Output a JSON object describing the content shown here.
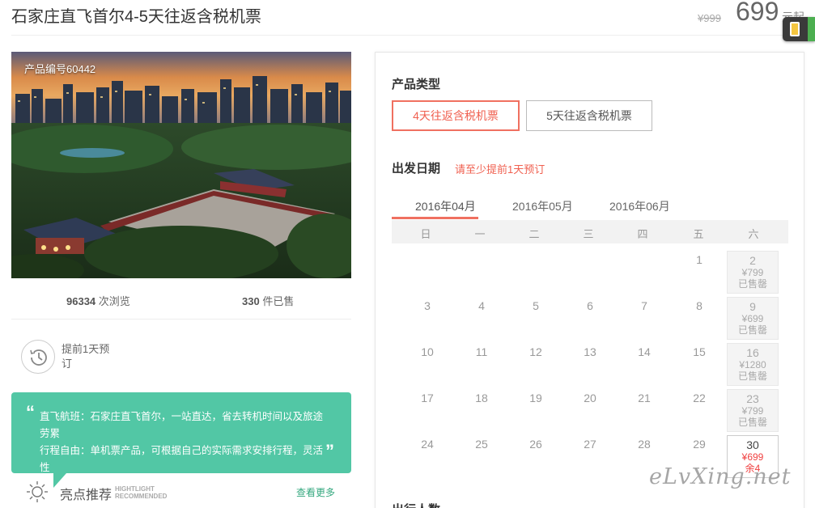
{
  "header": {
    "title": "石家庄直飞首尔4-5天往返含税机票",
    "original_price": "¥999",
    "price": "699",
    "price_unit": "元起"
  },
  "gallery": {
    "product_code": "产品编号60442",
    "views_count": "96334",
    "views_label": "次浏览",
    "sold_count": "330",
    "sold_label": "件已售"
  },
  "advance_booking": {
    "text": "提前1天预订"
  },
  "description": {
    "line1": "直飞航班：石家庄直飞首尔，一站直达，省去转机时间以及旅途劳累",
    "line2": "行程自由：单机票产品，可根据自己的实际需求安排行程，灵活性"
  },
  "highlights": {
    "title": "亮点推荐",
    "en_line1": "HIGHTLIGHT",
    "en_line2": "RECOMMENDED",
    "more": "查看更多"
  },
  "booking": {
    "product_type_label": "产品类型",
    "types": [
      "4天往返含税机票",
      "5天往返含税机票"
    ],
    "selected_type": "4天往返含税机票",
    "date_label": "出发日期",
    "date_tip": "请至少提前1天预订",
    "months": [
      "2016年04月",
      "2016年05月",
      "2016年06月"
    ],
    "selected_month": "2016年04月",
    "weekdays": [
      "日",
      "一",
      "二",
      "三",
      "四",
      "五",
      "六"
    ],
    "travelers_label": "出行人数"
  },
  "calendar": {
    "row1": [
      {
        "day": "",
        "price": "",
        "status": ""
      },
      {
        "day": "",
        "price": "",
        "status": ""
      },
      {
        "day": "",
        "price": "",
        "status": ""
      },
      {
        "day": "",
        "price": "",
        "status": ""
      },
      {
        "day": "",
        "price": "",
        "status": ""
      },
      {
        "day": "1",
        "price": "",
        "status": ""
      },
      {
        "day": "2",
        "price": "¥799",
        "status": "已售罄"
      }
    ],
    "row2": [
      {
        "day": "3",
        "price": "",
        "status": ""
      },
      {
        "day": "4",
        "price": "",
        "status": ""
      },
      {
        "day": "5",
        "price": "",
        "status": ""
      },
      {
        "day": "6",
        "price": "",
        "status": ""
      },
      {
        "day": "7",
        "price": "",
        "status": ""
      },
      {
        "day": "8",
        "price": "",
        "status": ""
      },
      {
        "day": "9",
        "price": "¥699",
        "status": "已售罄"
      }
    ],
    "row3": [
      {
        "day": "10",
        "price": "",
        "status": ""
      },
      {
        "day": "11",
        "price": "",
        "status": ""
      },
      {
        "day": "12",
        "price": "",
        "status": ""
      },
      {
        "day": "13",
        "price": "",
        "status": ""
      },
      {
        "day": "14",
        "price": "",
        "status": ""
      },
      {
        "day": "15",
        "price": "",
        "status": ""
      },
      {
        "day": "16",
        "price": "¥1280",
        "status": "已售罄"
      }
    ],
    "row4": [
      {
        "day": "17",
        "price": "",
        "status": ""
      },
      {
        "day": "18",
        "price": "",
        "status": ""
      },
      {
        "day": "19",
        "price": "",
        "status": ""
      },
      {
        "day": "20",
        "price": "",
        "status": ""
      },
      {
        "day": "21",
        "price": "",
        "status": ""
      },
      {
        "day": "22",
        "price": "",
        "status": ""
      },
      {
        "day": "23",
        "price": "¥799",
        "status": "已售罄"
      }
    ],
    "row5": [
      {
        "day": "24",
        "price": "",
        "status": ""
      },
      {
        "day": "25",
        "price": "",
        "status": ""
      },
      {
        "day": "26",
        "price": "",
        "status": ""
      },
      {
        "day": "27",
        "price": "",
        "status": ""
      },
      {
        "day": "28",
        "price": "",
        "status": ""
      },
      {
        "day": "29",
        "price": "",
        "status": ""
      },
      {
        "day": "30",
        "price": "¥699",
        "status": "余4"
      }
    ]
  },
  "watermark": "eLvXing.net",
  "colors": {
    "accent": "#f06050",
    "bubble": "#52c7a5",
    "link_green": "#35a87f"
  }
}
